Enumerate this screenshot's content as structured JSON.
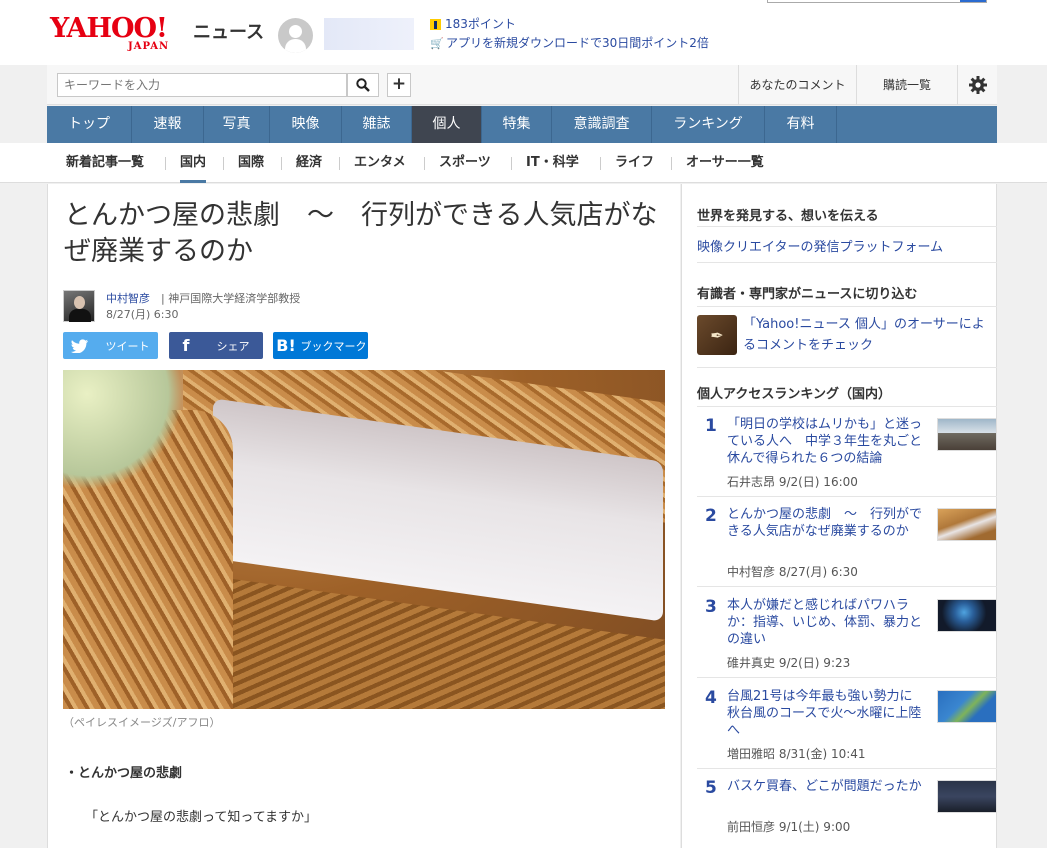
{
  "header": {
    "logo_main": "YAHOO!",
    "logo_sub": "JAPAN",
    "logo_service": "ニュース",
    "points": "183ポイント",
    "promo": "アプリを新規ダウンロードで30日間ポイント2倍",
    "search_placeholder": "キーワードを入力",
    "your_comments": "あなたのコメント",
    "subscriptions": "購読一覧"
  },
  "main_nav": [
    "トップ",
    "速報",
    "写真",
    "映像",
    "雑誌",
    "個人",
    "特集",
    "意識調査",
    "ランキング",
    "有料"
  ],
  "sub_nav": [
    "新着記事一覧",
    "国内",
    "国際",
    "経済",
    "エンタメ",
    "スポーツ",
    "IT・科学",
    "ライフ",
    "オーサー一覧"
  ],
  "article": {
    "title": "とんかつ屋の悲劇　～　行列ができる人気店がなぜ廃業するのか",
    "author": "中村智彦",
    "author_title": "| 神戸国際大学経済学部教授",
    "date": "8/27(月) 6:30",
    "share_twitter": "ツイート",
    "share_facebook": "シェア",
    "share_hatena": "ブックマーク",
    "caption": "（ペイレスイメージズ/アフロ）",
    "subheading": "・とんかつ屋の悲劇",
    "quote": "「とんかつ屋の悲劇って知ってますか」"
  },
  "sidebar": {
    "h1": "世界を発見する、想いを伝える",
    "link1": "映像クリエイターの発信プラットフォーム",
    "h2": "有識者・専門家がニュースに切り込む",
    "promo": "「Yahoo!ニュース 個人」のオーサーによるコメントをチェック",
    "ranking_title": "個人アクセスランキング（国内）",
    "ranking": [
      {
        "num": "1",
        "title": "「明日の学校はムリかも」と迷っている人へ　中学３年生を丸ごと休んで得られた６つの結論",
        "meta": "石井志昂 9/2(日) 16:00"
      },
      {
        "num": "2",
        "title": "とんかつ屋の悲劇　～　行列ができる人気店がなぜ廃業するのか",
        "meta": "中村智彦 8/27(月) 6:30"
      },
      {
        "num": "3",
        "title": "本人が嫌だと感じればパワハラか：指導、いじめ、体罰、暴力との違い",
        "meta": "碓井真史 9/2(日) 9:23"
      },
      {
        "num": "4",
        "title": "台風21号は今年最も強い勢力に　秋台風のコースで火～水曜に上陸へ",
        "meta": "増田雅昭 8/31(金) 10:41"
      },
      {
        "num": "5",
        "title": "バスケ買春、どこが問題だったか",
        "meta": "前田恒彦 9/1(土) 9:00"
      }
    ]
  },
  "colors": {
    "nav": "#4a79a4",
    "nav_active": "#3f4550",
    "link": "#2a4aa0",
    "brand": "#e60012"
  }
}
